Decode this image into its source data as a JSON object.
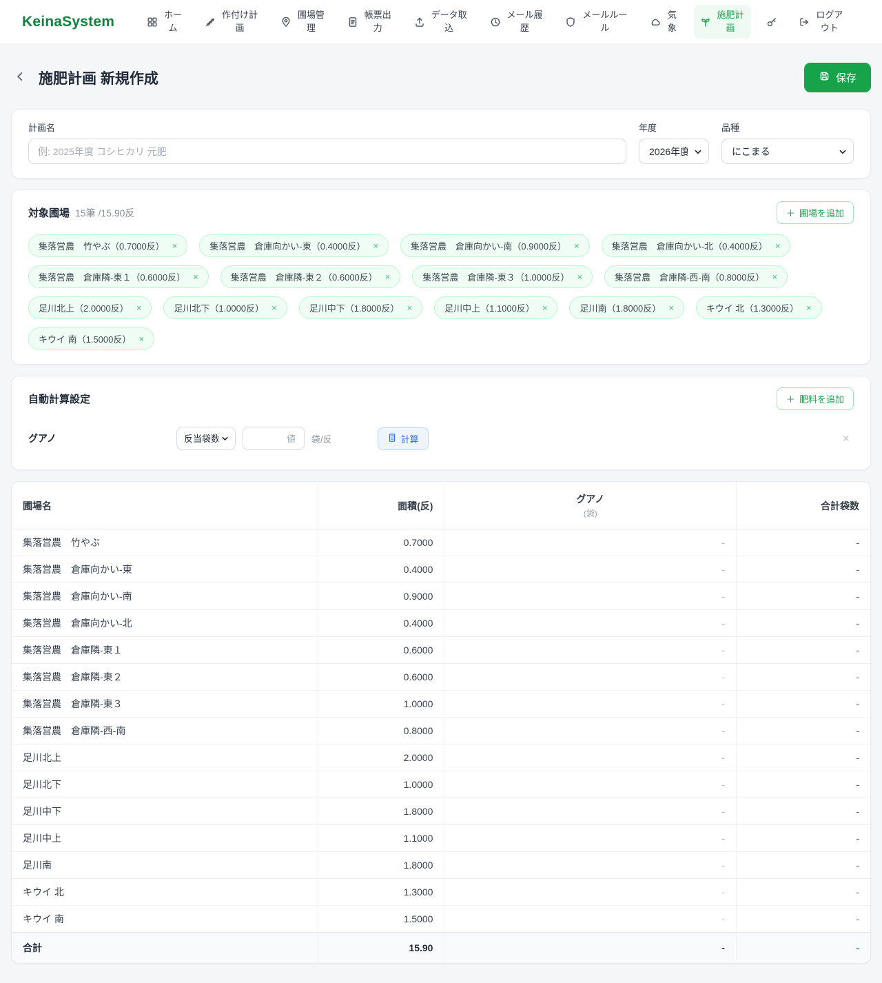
{
  "brand": "KeinaSystem",
  "icons": {
    "plus": "＋",
    "close": "×"
  },
  "nav": {
    "items": [
      {
        "id": "home",
        "label": "ホーム",
        "icon": "grid-icon"
      },
      {
        "id": "planting-plan",
        "label": "作付け計画",
        "icon": "wheat-icon"
      },
      {
        "id": "field-management",
        "label": "圃場管理",
        "icon": "map-pin-icon"
      },
      {
        "id": "report-output",
        "label": "帳票出力",
        "icon": "document-icon"
      },
      {
        "id": "data-import",
        "label": "データ取込",
        "icon": "upload-icon"
      },
      {
        "id": "mail-history",
        "label": "メール履歴",
        "icon": "history-icon"
      },
      {
        "id": "mail-rules",
        "label": "メールルール",
        "icon": "shield-icon"
      },
      {
        "id": "weather",
        "label": "気象",
        "icon": "cloud-icon"
      },
      {
        "id": "fertilizer-plan",
        "label": "施肥計画",
        "icon": "sprout-icon",
        "active": true
      },
      {
        "id": "key",
        "label": "",
        "icon": "key-icon"
      },
      {
        "id": "logout",
        "label": "ログアウト",
        "icon": "logout-icon"
      }
    ]
  },
  "header": {
    "title": "施肥計画 新規作成",
    "save_label": "保存"
  },
  "plan_form": {
    "name_label": "計画名",
    "name_placeholder": "例: 2025年度 コシヒカリ 元肥",
    "year_label": "年度",
    "year_value": "2026年度",
    "variety_label": "品種",
    "variety_value": "にこまる"
  },
  "target_fields": {
    "title": "対象圃場",
    "count_text": "15筆 /15.90反",
    "add_label": "圃場を追加",
    "tags": [
      "集落営農　竹やぶ（0.7000反）",
      "集落営農　倉庫向かい-東（0.4000反）",
      "集落営農　倉庫向かい-南（0.9000反）",
      "集落営農　倉庫向かい-北（0.4000反）",
      "集落営農　倉庫隣-東１（0.6000反）",
      "集落営農　倉庫隣-東２（0.6000反）",
      "集落営農　倉庫隣-東３（1.0000反）",
      "集落営農　倉庫隣-西-南（0.8000反）",
      "足川北上（2.0000反）",
      "足川北下（1.0000反）",
      "足川中下（1.8000反）",
      "足川中上（1.1000反）",
      "足川南（1.8000反）",
      "キウイ 北（1.3000反）",
      "キウイ 南（1.5000反）"
    ]
  },
  "auto_calc": {
    "title": "自動計算設定",
    "add_label": "肥料を追加",
    "fertilizer_name": "グアノ",
    "method_value": "反当袋数",
    "value_placeholder": "値",
    "unit": "袋/反",
    "calc_label": "計算"
  },
  "table": {
    "headers": {
      "field": "圃場名",
      "area": "面積(反)",
      "fertilizer": "グアノ",
      "fertilizer_unit": "(袋)",
      "total": "合計袋数"
    },
    "empty_value": "-",
    "rows": [
      {
        "name": "集落営農　竹やぶ",
        "area": "0.7000"
      },
      {
        "name": "集落営農　倉庫向かい-東",
        "area": "0.4000"
      },
      {
        "name": "集落営農　倉庫向かい-南",
        "area": "0.9000"
      },
      {
        "name": "集落営農　倉庫向かい-北",
        "area": "0.4000"
      },
      {
        "name": "集落営農　倉庫隣-東１",
        "area": "0.6000"
      },
      {
        "name": "集落営農　倉庫隣-東２",
        "area": "0.6000"
      },
      {
        "name": "集落営農　倉庫隣-東３",
        "area": "1.0000"
      },
      {
        "name": "集落営農　倉庫隣-西-南",
        "area": "0.8000"
      },
      {
        "name": "足川北上",
        "area": "2.0000"
      },
      {
        "name": "足川北下",
        "area": "1.0000"
      },
      {
        "name": "足川中下",
        "area": "1.8000"
      },
      {
        "name": "足川中上",
        "area": "1.1000"
      },
      {
        "name": "足川南",
        "area": "1.8000"
      },
      {
        "name": "キウイ 北",
        "area": "1.3000"
      },
      {
        "name": "キウイ 南",
        "area": "1.5000"
      }
    ],
    "total": {
      "label": "合計",
      "area": "15.90",
      "fertilizer": "-",
      "total": "-"
    }
  }
}
